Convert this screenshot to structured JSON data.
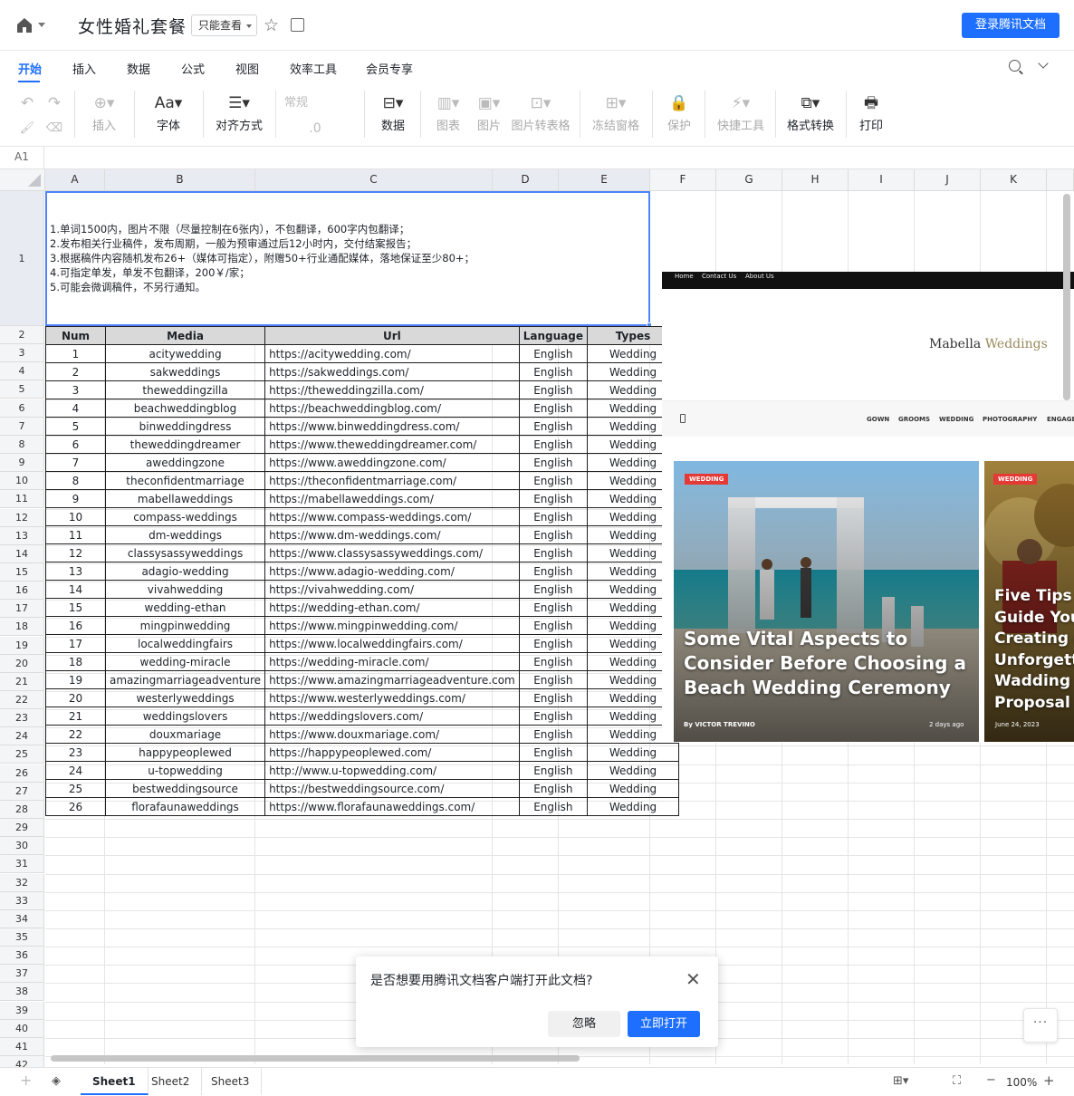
{
  "header": {
    "title": "女性婚礼套餐",
    "mode": "只能查看",
    "login": "登录腾讯文档"
  },
  "menu": [
    "开始",
    "插入",
    "数据",
    "公式",
    "视图",
    "效率工具",
    "会员专享"
  ],
  "toolbar": {
    "insert": "插入",
    "font": "字体",
    "align": "对齐方式",
    "format": "常规",
    "decimal": ".0",
    "data": "数据",
    "chart": "图表",
    "image": "图片",
    "img2table": "图片转表格",
    "freeze": "冻结窗格",
    "protect": "保护",
    "quick": "快捷工具",
    "convert": "格式转换",
    "print": "打印"
  },
  "formula": {
    "cell": "A1"
  },
  "columns": [
    "A",
    "B",
    "C",
    "D",
    "E",
    "F",
    "G",
    "H",
    "I",
    "J",
    "K"
  ],
  "note": "1.单词1500内，图片不限（尽量控制在6张内），不包翻译，600字内包翻译；\n2.发布相关行业稿件，发布周期，一般为预审通过后12小时内，交付结案报告；\n3.根据稿件内容随机发布26+（媒体可指定），附赠50+行业通配媒体，落地保证至少80+；\n4.可指定单发，单发不包翻译，200￥/家；\n5.可能会微调稿件，不另行通知。",
  "table": {
    "headers": [
      "Num",
      "Media",
      "Url",
      "Language",
      "Types"
    ],
    "rows": [
      [
        "1",
        "acitywedding",
        "https://acitywedding.com/",
        "English",
        "Wedding"
      ],
      [
        "2",
        "sakweddings",
        "https://sakweddings.com/",
        "English",
        "Wedding"
      ],
      [
        "3",
        "theweddingzilla",
        "https://theweddingzilla.com/",
        "English",
        "Wedding"
      ],
      [
        "4",
        "beachweddingblog",
        "https://beachweddingblog.com/",
        "English",
        "Wedding"
      ],
      [
        "5",
        "binweddingdress",
        "https://www.binweddingdress.com/",
        "English",
        "Wedding"
      ],
      [
        "6",
        "theweddingdreamer",
        "https://www.theweddingdreamer.com/",
        "English",
        "Wedding"
      ],
      [
        "7",
        "aweddingzone",
        "https://www.aweddingzone.com/",
        "English",
        "Wedding"
      ],
      [
        "8",
        "theconfidentmarriage",
        "https://theconfidentmarriage.com/",
        "English",
        "Wedding"
      ],
      [
        "9",
        "mabellaweddings",
        "https://mabellaweddings.com/",
        "English",
        "Wedding"
      ],
      [
        "10",
        "compass-weddings",
        "https://www.compass-weddings.com/",
        "English",
        "Wedding"
      ],
      [
        "11",
        "dm-weddings",
        "https://www.dm-weddings.com/",
        "English",
        "Wedding"
      ],
      [
        "12",
        "classysassyweddings",
        "https://www.classysassyweddings.com/",
        "English",
        "Wedding"
      ],
      [
        "13",
        "adagio-wedding",
        "https://www.adagio-wedding.com/",
        "English",
        "Wedding"
      ],
      [
        "14",
        "vivahwedding",
        "https://vivahwedding.com/",
        "English",
        "Wedding"
      ],
      [
        "15",
        "wedding-ethan",
        "https://wedding-ethan.com/",
        "English",
        "Wedding"
      ],
      [
        "16",
        "mingpinwedding",
        "https://www.mingpinwedding.com/",
        "English",
        "Wedding"
      ],
      [
        "17",
        "localweddingfairs",
        "https://www.localweddingfairs.com/",
        "English",
        "Wedding"
      ],
      [
        "18",
        "wedding-miracle",
        "https://wedding-miracle.com/",
        "English",
        "Wedding"
      ],
      [
        "19",
        "amazingmarriageadventure",
        "https://www.amazingmarriageadventure.com",
        "English",
        "Wedding"
      ],
      [
        "20",
        "westerlyweddings",
        "https://www.westerlyweddings.com/",
        "English",
        "Wedding"
      ],
      [
        "21",
        "weddingslovers",
        "https://weddingslovers.com/",
        "English",
        "Wedding"
      ],
      [
        "22",
        "douxmariage",
        "https://www.douxmariage.com/",
        "English",
        "Wedding"
      ],
      [
        "23",
        "happypeoplewed",
        "https://happypeoplewed.com/",
        "English",
        "Wedding"
      ],
      [
        "24",
        "u-topwedding",
        "http://www.u-topwedding.com/",
        "English",
        "Wedding"
      ],
      [
        "25",
        "bestweddingsource",
        "https://bestweddingsource.com/",
        "English",
        "Wedding"
      ],
      [
        "26",
        "florafaunaweddings",
        "https://www.florafaunaweddings.com/",
        "English",
        "Wedding"
      ]
    ]
  },
  "web": {
    "nav": [
      "Home",
      "Contact Us",
      "About Us"
    ],
    "logo_a": "Mabella",
    "logo_b": "Weddings",
    "menu": [
      "GOWN",
      "GROOMS",
      "WEDDING",
      "PHOTOGRAPHY",
      "ENGAGE"
    ],
    "card1": {
      "badge": "WEDDING",
      "title": "Some Vital Aspects to Consider Before Choosing a Beach Wedding Ceremony",
      "by": "By VICTOR TREVINO",
      "time": "2 days ago"
    },
    "card2": {
      "badge": "WEDDING",
      "title": "Five Tips to Guide You Creating an Unforgettable Wadding Proposal",
      "time": "June 24, 2023"
    }
  },
  "dialog": {
    "text": "是否想要用腾讯文档客户端打开此文档?",
    "ignore": "忽略",
    "open": "立即打开"
  },
  "sheets": [
    "Sheet1",
    "Sheet2",
    "Sheet3"
  ],
  "zoom": "100%",
  "more": "···"
}
